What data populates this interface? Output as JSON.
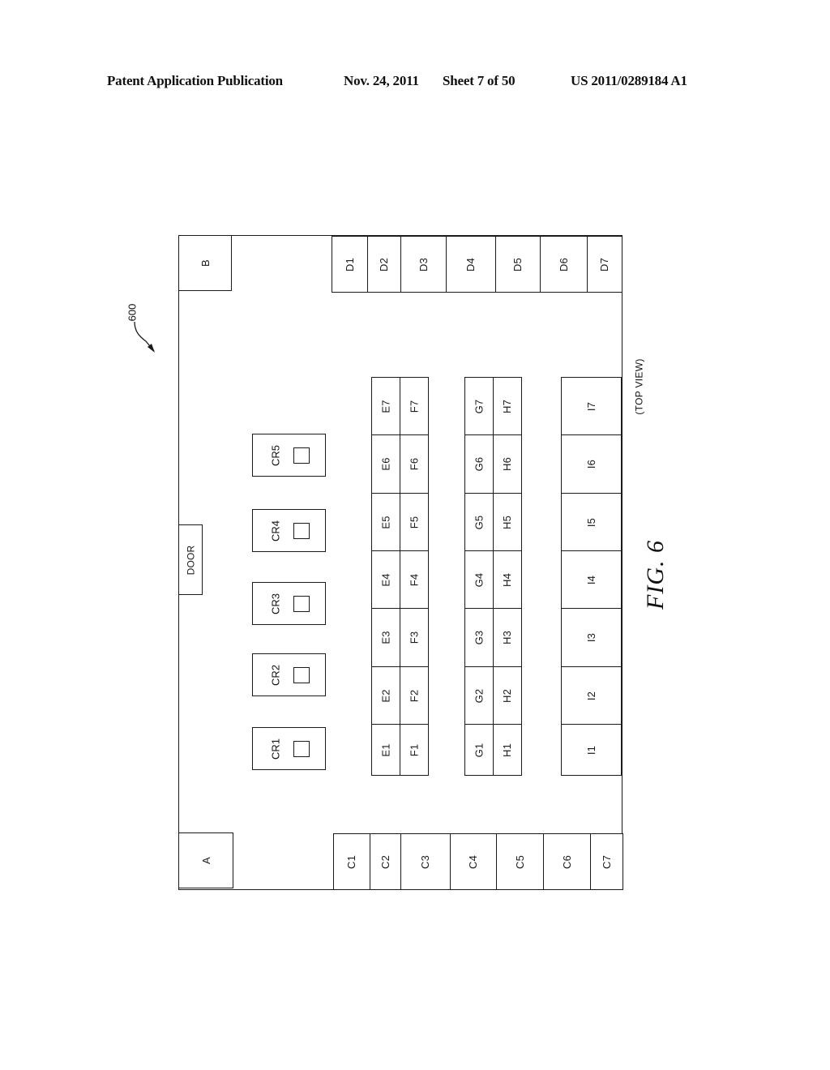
{
  "header": {
    "publication": "Patent Application Publication",
    "date": "Nov. 24, 2011",
    "sheet": "Sheet 7 of 50",
    "number": "US 2011/0289184 A1"
  },
  "figure": {
    "reference_numeral": "600",
    "view_label": "(TOP VIEW)",
    "caption": "FIG.  6"
  },
  "corners": {
    "top_left": "B",
    "bottom_left": "A"
  },
  "door_label": "DOOR",
  "top_row": [
    "D1",
    "D2",
    "D3",
    "D4",
    "D5",
    "D6",
    "D7"
  ],
  "bottom_row": [
    "C1",
    "C2",
    "C3",
    "C4",
    "C5",
    "C6",
    "C7"
  ],
  "control_racks": [
    "CR1",
    "CR2",
    "CR3",
    "CR4",
    "CR5"
  ],
  "row_e": [
    "E1",
    "E2",
    "E3",
    "E4",
    "E5",
    "E6",
    "E7"
  ],
  "row_f": [
    "F1",
    "F2",
    "F3",
    "F4",
    "F5",
    "F6",
    "F7"
  ],
  "row_g": [
    "G1",
    "G2",
    "G3",
    "G4",
    "G5",
    "G6",
    "G7"
  ],
  "row_h": [
    "H1",
    "H2",
    "H3",
    "H4",
    "H5",
    "H6",
    "H7"
  ],
  "row_i": [
    "I1",
    "I2",
    "I3",
    "I4",
    "I5",
    "I6",
    "I7"
  ]
}
